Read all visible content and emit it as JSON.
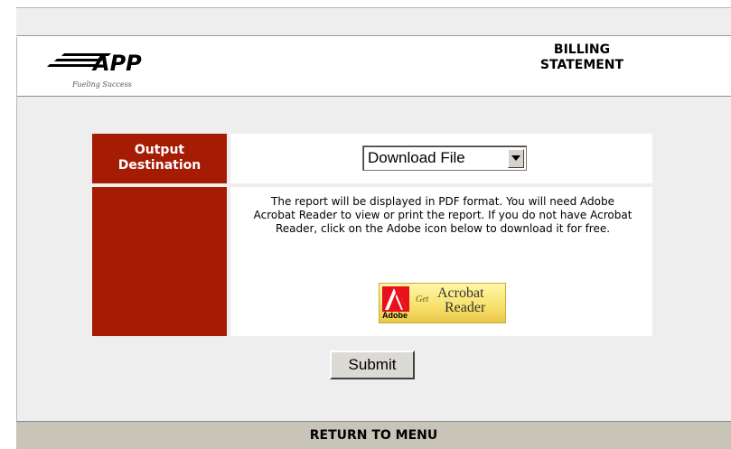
{
  "header": {
    "logo_text": "APP",
    "tagline": "Fueling Success",
    "title_line1": "BILLING",
    "title_line2": "STATEMENT"
  },
  "form": {
    "output_label_line1": "Output",
    "output_label_line2": "Destination",
    "output_select_value": "Download File",
    "note": "The report will be displayed in PDF format. You will need Adobe Acrobat Reader to view or print the report. If you do not have Acrobat Reader, click on the Adobe icon below to download it for free.",
    "adobe_badge": {
      "adobe_word": "Adobe",
      "get": "Get",
      "acrobat": "Acrobat",
      "reader": "Reader"
    },
    "submit_label": "Submit"
  },
  "footer": {
    "return_label": "RETURN TO MENU"
  },
  "colors": {
    "label_bg": "#a51b04",
    "footer_bg": "#c8c5b8",
    "panel_bg": "#efeeee"
  }
}
